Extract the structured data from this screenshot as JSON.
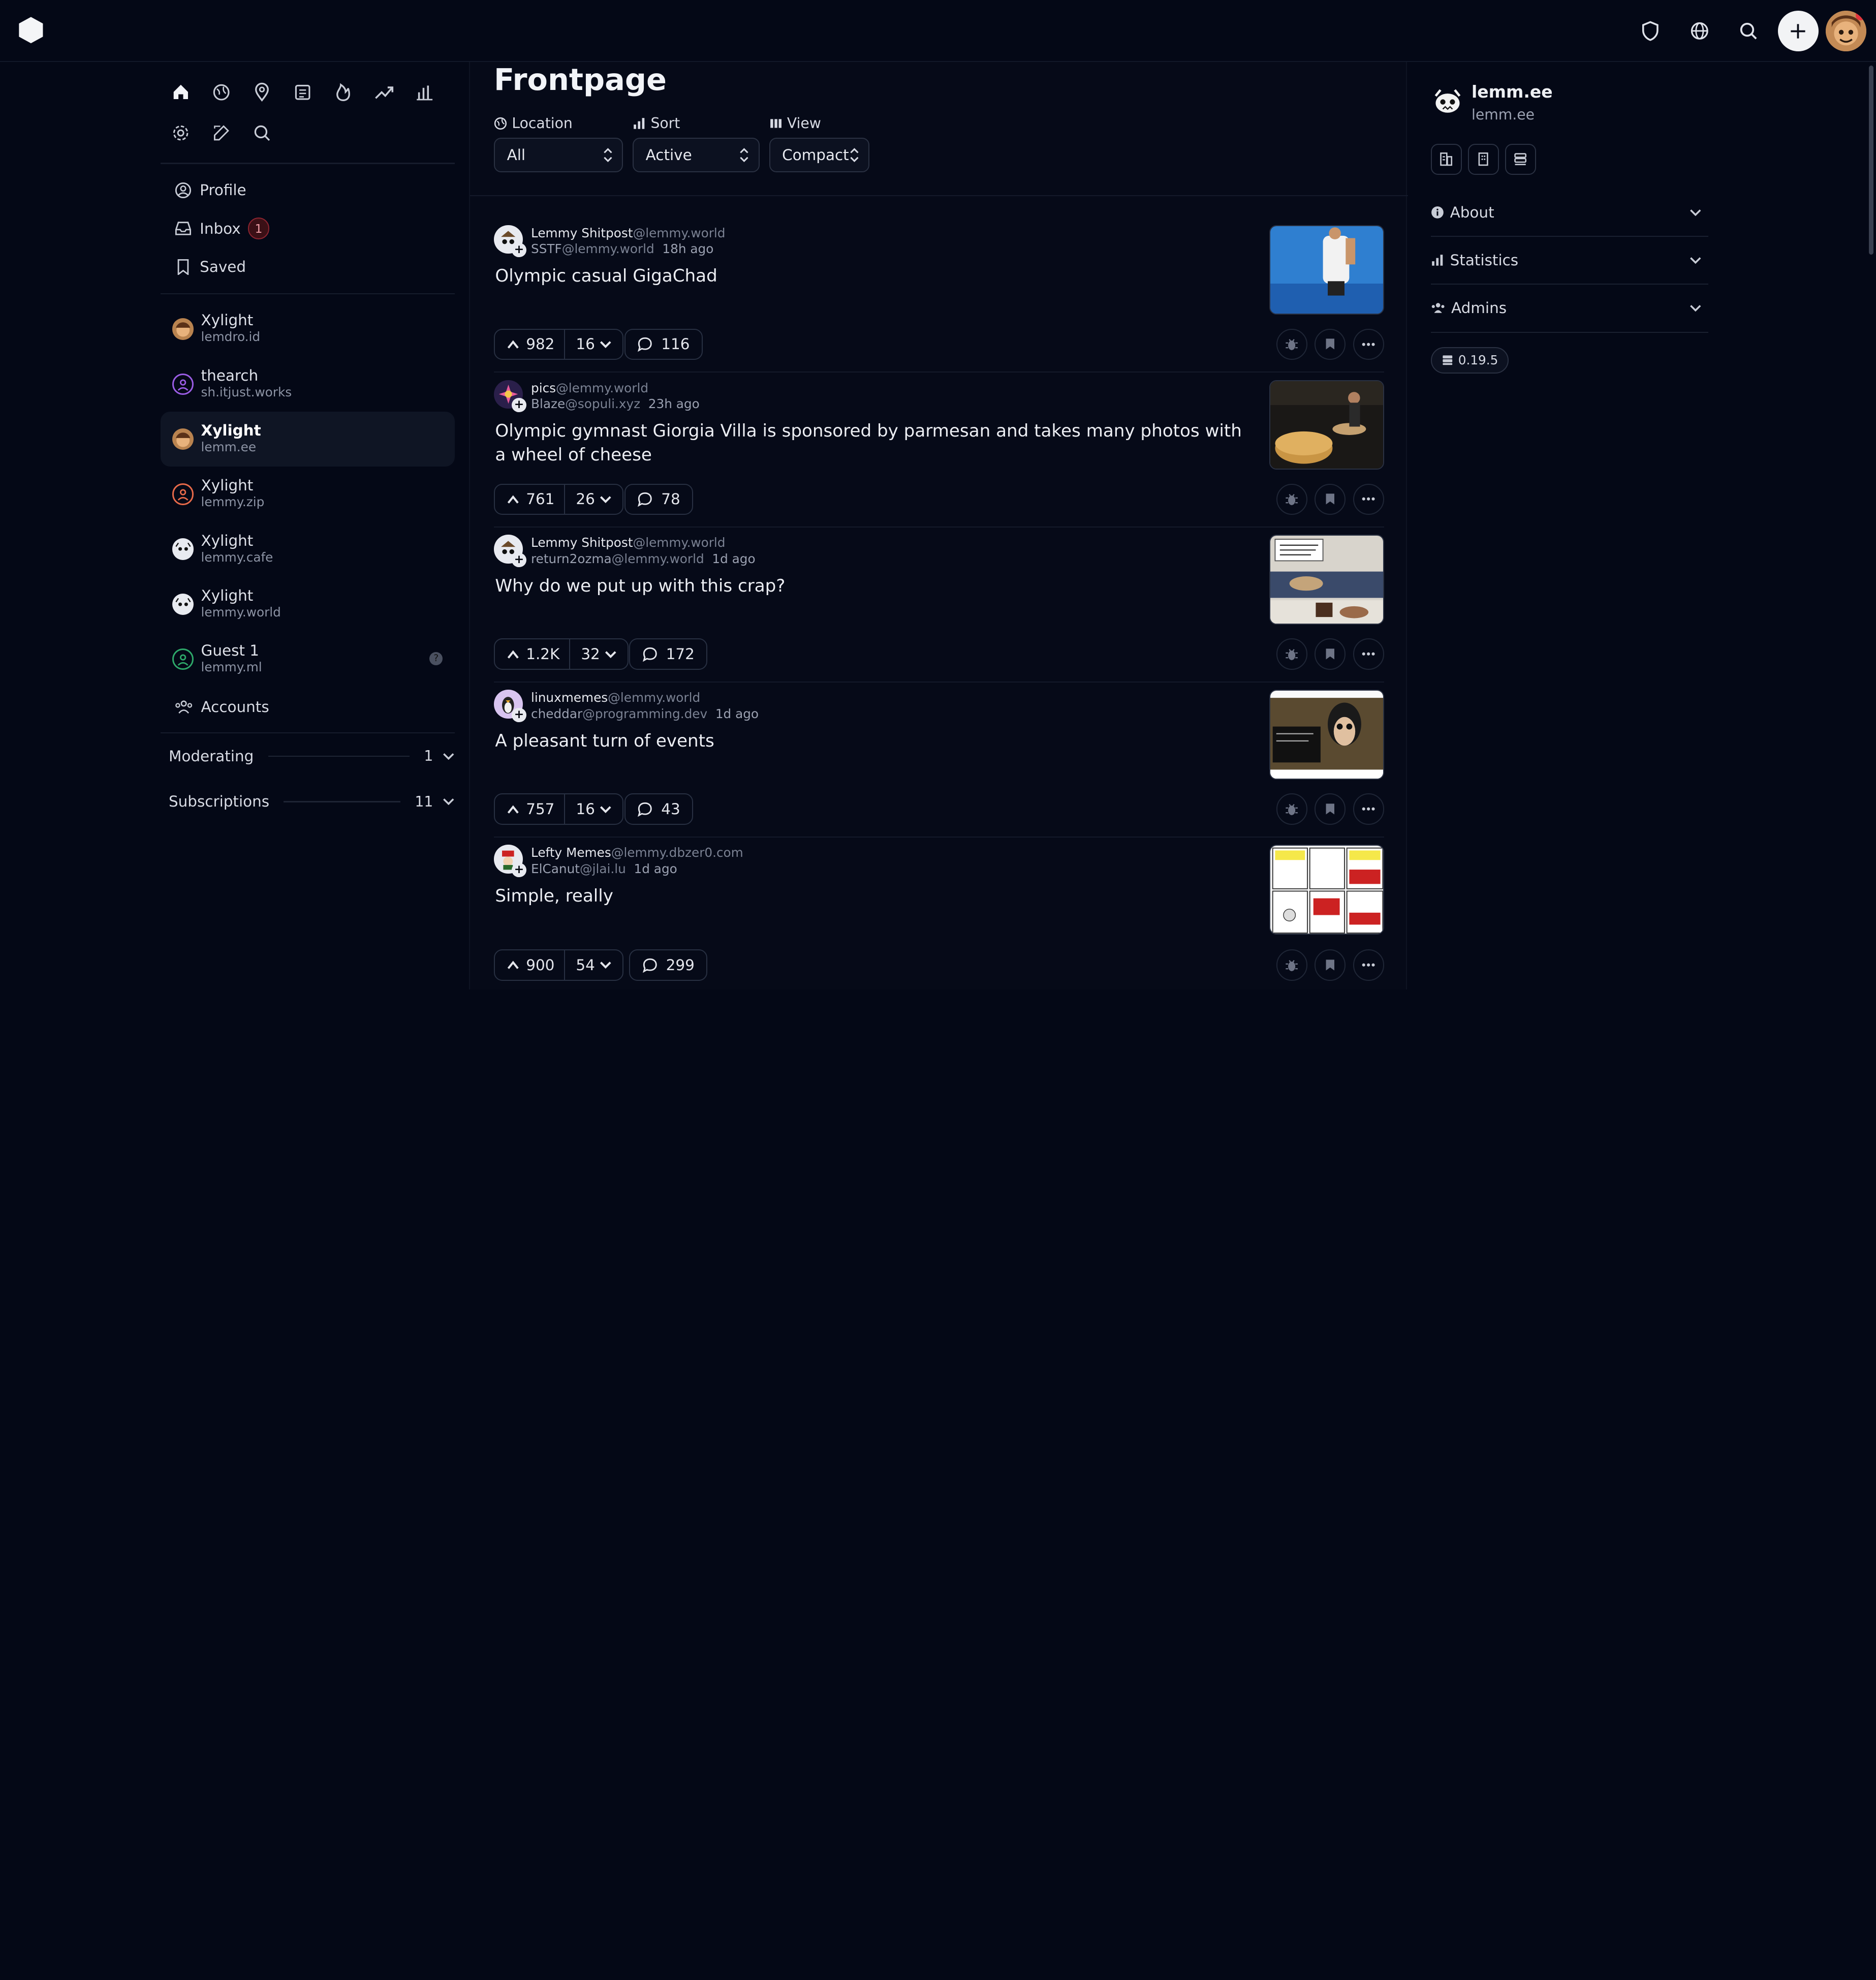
{
  "header": {
    "logo_icon": "lemmy-hexagon-icon"
  },
  "nav_icons": [
    "home-icon",
    "globe-icon",
    "location-icon",
    "feed-icon",
    "fire-icon",
    "trending-icon",
    "chart-icon",
    "settings-icon",
    "edit-icon",
    "search-icon"
  ],
  "sidebar": {
    "profile": "Profile",
    "inbox": "Inbox",
    "inbox_count": "1",
    "saved": "Saved",
    "accounts": [
      {
        "name": "Xylight",
        "instance": "lemdro.id"
      },
      {
        "name": "thearch",
        "instance": "sh.itjust.works"
      },
      {
        "name": "Xylight",
        "instance": "lemm.ee"
      },
      {
        "name": "Xylight",
        "instance": "lemmy.zip"
      },
      {
        "name": "Xylight",
        "instance": "lemmy.cafe"
      },
      {
        "name": "Xylight",
        "instance": "lemmy.world"
      },
      {
        "name": "Guest 1",
        "instance": "lemmy.ml"
      }
    ],
    "accounts_label": "Accounts",
    "moderating_label": "Moderating",
    "moderating_count": "1",
    "subscriptions_label": "Subscriptions",
    "subscriptions_count": "11"
  },
  "main": {
    "title": "Frontpage",
    "filters": {
      "location_label": "Location",
      "location_value": "All",
      "sort_label": "Sort",
      "sort_value": "Active",
      "view_label": "View",
      "view_value": "Compact"
    },
    "posts": [
      {
        "community": "Lemmy Shitpost",
        "community_domain": "@lemmy.world",
        "creator": "SSTF",
        "creator_domain": "@lemmy.world",
        "time": "18h ago",
        "title": "Olympic casual GigaChad",
        "upvotes": "982",
        "downvotes": "16",
        "comments": "116"
      },
      {
        "community": "pics",
        "community_domain": "@lemmy.world",
        "creator": "Blaze",
        "creator_domain": "@sopuli.xyz",
        "time": "23h ago",
        "title": "Olympic gymnast Giorgia Villa is sponsored by parmesan and takes many photos with a wheel of cheese",
        "upvotes": "761",
        "downvotes": "26",
        "comments": "78"
      },
      {
        "community": "Lemmy Shitpost",
        "community_domain": "@lemmy.world",
        "creator": "return2ozma",
        "creator_domain": "@lemmy.world",
        "time": "1d ago",
        "title": "Why do we put up with this crap?",
        "upvotes": "1.2K",
        "downvotes": "32",
        "comments": "172"
      },
      {
        "community": "linuxmemes",
        "community_domain": "@lemmy.world",
        "creator": "cheddar",
        "creator_domain": "@programming.dev",
        "time": "1d ago",
        "title": "A pleasant turn of events",
        "upvotes": "757",
        "downvotes": "16",
        "comments": "43"
      },
      {
        "community": "Lefty Memes",
        "community_domain": "@lemmy.dbzer0.com",
        "creator": "ElCanut",
        "creator_domain": "@jlai.lu",
        "time": "1d ago",
        "title": "Simple, really",
        "upvotes": "900",
        "downvotes": "54",
        "comments": "299"
      }
    ]
  },
  "right": {
    "instance_name": "lemm.ee",
    "instance_domain": "lemm.ee",
    "about": "About",
    "statistics": "Statistics",
    "admins": "Admins",
    "version": "0.19.5"
  },
  "colors": {
    "background": "#040816",
    "accent": "#f2f3f5",
    "badge": "#8d2430"
  }
}
